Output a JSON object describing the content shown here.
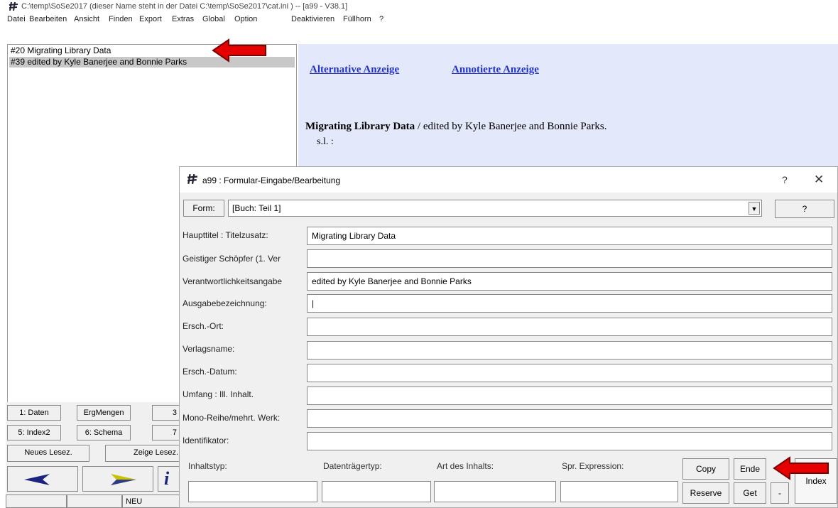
{
  "window": {
    "title": "C:\\temp\\SoSe2017   (dieser Name steht in der Datei C:\\temp\\SoSe2017\\cat.ini ) -- [a99 - V38.1]"
  },
  "menu": [
    "Datei",
    "Bearbeiten",
    "Ansicht",
    "Finden",
    "Export",
    "Extras",
    "Global",
    "Option",
    "Deaktivieren",
    "Füllhorn",
    "?"
  ],
  "list": {
    "items": [
      "#20 Migrating Library Data",
      "#39 edited by Kyle Banerjee and Bonnie Parks"
    ]
  },
  "view": {
    "link1": "Alternative Anzeige",
    "link2": "Annotierte Anzeige",
    "title_bold": "Migrating Library Data",
    "title_rest": " / edited by Kyle Banerjee and Bonnie Parks.",
    "sub": "s.l. :"
  },
  "left_buttons": {
    "b1": "1: Daten",
    "b2": "ErgMengen",
    "b3": "3",
    "b4": "5: Index2",
    "b5": "6: Schema",
    "b6": "7",
    "b7": "Neues Lesez.",
    "b8": "Zeige Lesez.",
    "neu": "NEU"
  },
  "dialog": {
    "title": "a99 : Formular-Eingabe/Bearbeitung",
    "help": "?",
    "close": "✕",
    "form_button": "Form:",
    "form_value": "[Buch: Teil 1]",
    "form_help": "?",
    "fields": [
      {
        "label": "Haupttitel : Titelzusatz:",
        "value": "Migrating Library Data"
      },
      {
        "label": "Geistiger Schöpfer (1. Ver",
        "value": ""
      },
      {
        "label": "Verantwortlichkeitsangabe",
        "value": "edited by Kyle Banerjee and Bonnie Parks"
      },
      {
        "label": "Ausgabebezeichnung:",
        "value": "|"
      },
      {
        "label": "Ersch.-Ort:",
        "value": ""
      },
      {
        "label": "Verlagsname:",
        "value": ""
      },
      {
        "label": "Ersch.-Datum:",
        "value": ""
      },
      {
        "label": "Umfang : Ill. Inhalt.",
        "value": ""
      },
      {
        "label": "Mono-Reihe/mehrt. Werk:",
        "value": ""
      },
      {
        "label": "Identifikator:",
        "value": ""
      }
    ],
    "bottom_labels": [
      "Inhaltstyp:",
      "Datenträgertyp:",
      "Art des Inhalts:",
      "Spr. Expression:"
    ],
    "buttons": {
      "copy": "Copy",
      "ende": "Ende",
      "reserve": "Reserve",
      "get": "Get",
      "minus": "-",
      "index": "Index"
    }
  },
  "colors": {
    "arrow": "#e60000",
    "view_bg": "#e4e8fb",
    "link": "#2233cc"
  }
}
